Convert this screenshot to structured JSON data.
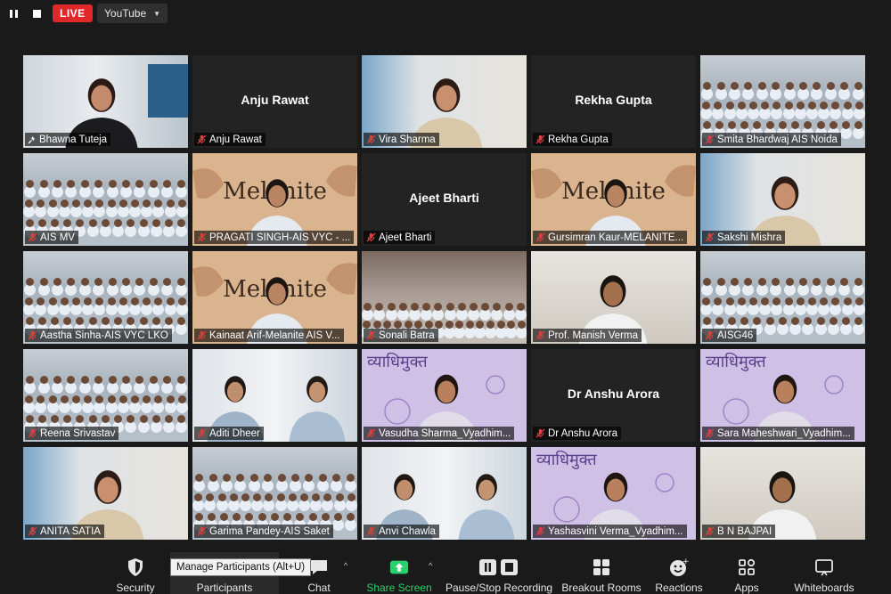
{
  "topbar": {
    "live_label": "LIVE",
    "destination": "YouTube"
  },
  "participants": [
    {
      "name": "Bhawna Tuteja",
      "pinned": true,
      "active": true,
      "video": "presenter"
    },
    {
      "name": "Anju Rawat",
      "video": "off",
      "display_name": "Anju Rawat"
    },
    {
      "name": "Vira Sharma",
      "video": "woman"
    },
    {
      "name": "Rekha Gupta",
      "video": "off",
      "display_name": "Rekha Gupta"
    },
    {
      "name": "Smita Bhardwaj AIS Noida",
      "video": "crowd"
    },
    {
      "name": "AIS MV",
      "video": "crowd"
    },
    {
      "name": "PRAGATI SINGH-AIS VYC - ...",
      "video": "melanite"
    },
    {
      "name": "Ajeet Bharti",
      "video": "off",
      "display_name": "Ajeet Bharti"
    },
    {
      "name": "Gursimran Kaur-MELANITE...",
      "video": "melanite"
    },
    {
      "name": "Sakshi Mishra",
      "video": "woman"
    },
    {
      "name": "Aastha Sinha-AIS VYC LKO",
      "video": "crowd"
    },
    {
      "name": "Kainaat Arif-Melanite AIS V...",
      "video": "melanite"
    },
    {
      "name": "Sonali Batra",
      "video": "auditorium"
    },
    {
      "name": "Prof. Manish Verma",
      "video": "man"
    },
    {
      "name": "AISG46",
      "video": "crowd"
    },
    {
      "name": "Reena Srivastav",
      "video": "crowd"
    },
    {
      "name": "Aditi Dheer",
      "video": "two"
    },
    {
      "name": "Vasudha Sharma_Vyadhim...",
      "video": "vyadhi"
    },
    {
      "name": "Dr Anshu Arora",
      "video": "off",
      "display_name": "Dr Anshu Arora"
    },
    {
      "name": "Sara Maheshwari_Vyadhim...",
      "video": "vyadhi"
    },
    {
      "name": "ANITA SATIA",
      "video": "woman"
    },
    {
      "name": "Garima Pandey-AIS Saket",
      "video": "crowd"
    },
    {
      "name": "Anvi Chawla",
      "video": "two"
    },
    {
      "name": "Yashasvini Verma_Vyadhim...",
      "video": "vyadhi"
    },
    {
      "name": "B N BAJPAI",
      "video": "man"
    }
  ],
  "backdrop_text": {
    "melanite": "Melanite",
    "vyadhi": "व्याधिमुक्त"
  },
  "toolbar": {
    "security": "Security",
    "participants": "Participants",
    "chat": "Chat",
    "share": "Share Screen",
    "record": "Pause/Stop Recording",
    "breakout": "Breakout Rooms",
    "reactions": "Reactions",
    "apps": "Apps",
    "whiteboards": "Whiteboards",
    "tooltip": "Manage Participants (Alt+U)"
  },
  "colors": {
    "active_outline": "#d7e84a",
    "live": "#e02828",
    "share": "#2ad06b",
    "mic_muted": "#e23c3c"
  }
}
